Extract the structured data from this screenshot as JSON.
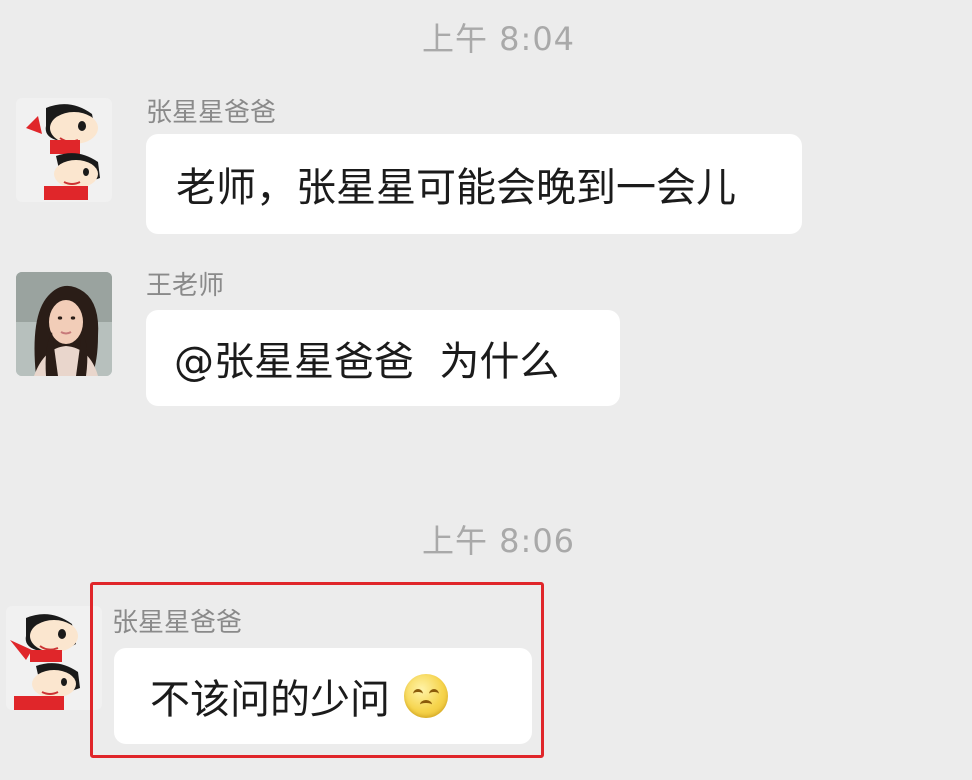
{
  "chat": {
    "timestamps": [
      "上午 8:04",
      "上午 8:06"
    ],
    "messages": [
      {
        "sender": "张星星爸爸",
        "avatar_icon": "crayon-shin-chan-avatar-icon",
        "text": "老师，张星星可能会晚到一会儿"
      },
      {
        "sender": "王老师",
        "avatar_icon": "teacher-photo-avatar-icon",
        "text": "@张星星爸爸  为什么"
      },
      {
        "sender": "张星星爸爸",
        "avatar_icon": "crayon-shin-chan-avatar-icon",
        "text": "不该问的少问",
        "emoji": "sly-smile-emoji-icon",
        "highlighted": true
      }
    ],
    "highlight_color": "#e0262a",
    "bubble_color": "#ffffff",
    "background_color": "#ececec"
  }
}
